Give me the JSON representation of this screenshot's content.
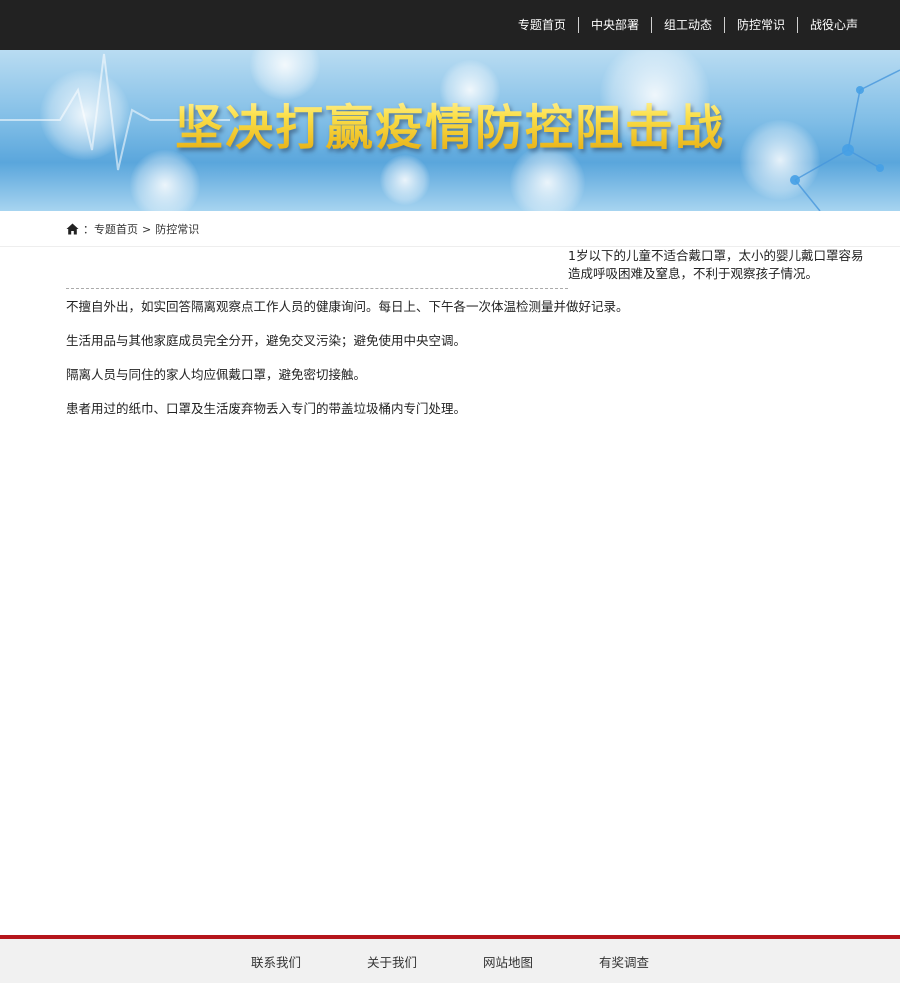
{
  "nav": {
    "items": [
      {
        "label": "专题首页"
      },
      {
        "label": "中央部署"
      },
      {
        "label": "组工动态"
      },
      {
        "label": "防控常识"
      },
      {
        "label": "战役心声"
      }
    ]
  },
  "banner": {
    "title": "坚决打赢疫情防控阻击战"
  },
  "breadcrumb": {
    "separator": "：",
    "home": "专题首页",
    "arrow": ">",
    "current": "防控常识"
  },
  "content": {
    "side_note": "1岁以下的儿童不适合戴口罩，太小的婴儿戴口罩容易造成呼吸困难及窒息，不利于观察孩子情况。",
    "paragraphs": [
      "不擅自外出，如实回答隔离观察点工作人员的健康询问。每日上、下午各一次体温检测量并做好记录。",
      "生活用品与其他家庭成员完全分开，避免交叉污染；避免使用中央空调。",
      "隔离人员与同住的家人均应佩戴口罩，避免密切接触。",
      "患者用过的纸巾、口罩及生活废弃物丢入专门的带盖垃圾桶内专门处理。"
    ]
  },
  "footer": {
    "links": [
      {
        "label": "联系我们"
      },
      {
        "label": "关于我们"
      },
      {
        "label": "网站地图"
      },
      {
        "label": "有奖调查"
      }
    ]
  },
  "colors": {
    "topbar": "#222222",
    "footer_accent": "#b5151b",
    "title_gold": "#f4d01a"
  }
}
